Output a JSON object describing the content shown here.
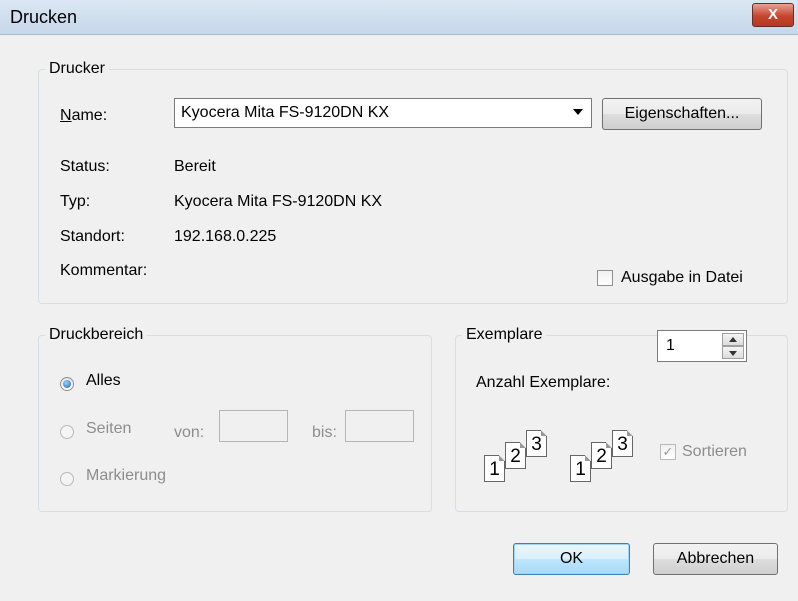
{
  "window": {
    "title": "Drucken",
    "close_glyph": "X"
  },
  "drucker": {
    "legend": "Drucker",
    "name_label": "Name:",
    "name_value": "Kyocera Mita FS-9120DN KX",
    "properties_button": "Eigenschaften...",
    "status_label": "Status:",
    "status_value": "Bereit",
    "typ_label": "Typ:",
    "typ_value": "Kyocera Mita FS-9120DN KX",
    "standort_label": "Standort:",
    "standort_value": "192.168.0.225",
    "kommentar_label": "Kommentar:",
    "ausgabe_label": "Ausgabe in Datei"
  },
  "druckbereich": {
    "legend": "Druckbereich",
    "alles": "Alles",
    "seiten": "Seiten",
    "von": "von:",
    "bis": "bis:",
    "markierung": "Markierung"
  },
  "exemplare": {
    "legend": "Exemplare",
    "anzahl_label": "Anzahl Exemplare:",
    "anzahl_value": "1",
    "sortieren": "Sortieren",
    "pages": [
      "1",
      "2",
      "3"
    ]
  },
  "buttons": {
    "ok": "OK",
    "cancel": "Abbrechen"
  }
}
